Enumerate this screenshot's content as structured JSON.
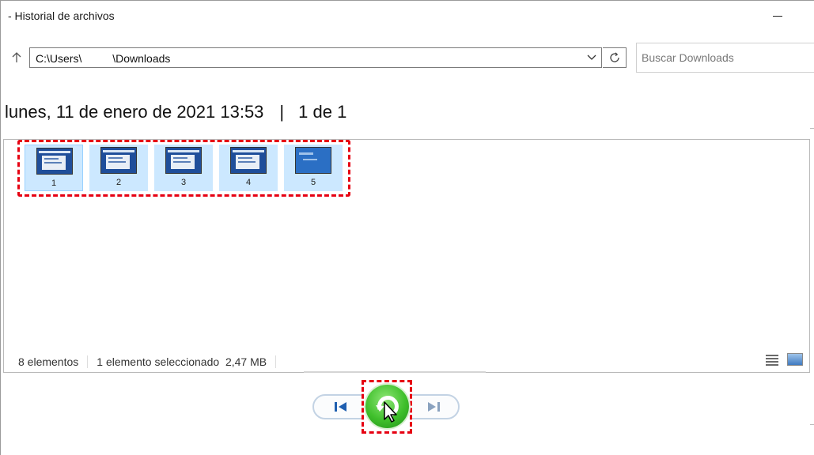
{
  "window": {
    "title": "- Historial de archivos"
  },
  "address_bar": {
    "path": "C:\\Users\\          \\Downloads"
  },
  "search": {
    "placeholder": "Buscar Downloads"
  },
  "snapshot": {
    "date": "lunes, 11 de enero de 2021 13:53",
    "separator": "|",
    "position": "1 de 1"
  },
  "thumbnails": [
    {
      "label": "1"
    },
    {
      "label": "2"
    },
    {
      "label": "3"
    },
    {
      "label": "4"
    },
    {
      "label": "5"
    }
  ],
  "status_bar": {
    "item_count": "8 elementos",
    "selection": "1 elemento seleccionado  2,47 MB"
  },
  "icons": {
    "up": "up-arrow-icon",
    "dropdown": "chevron-down-icon",
    "refresh": "refresh-icon",
    "minimize": "minimize-icon",
    "prev": "previous-version-icon",
    "next": "next-version-icon",
    "restore": "restore-icon",
    "details_view": "details-view-icon",
    "large_icons_view": "large-icons-view-icon"
  },
  "colors": {
    "selection": "#cce8ff",
    "highlight": "#e60012",
    "restore": "#3fbf2b"
  }
}
